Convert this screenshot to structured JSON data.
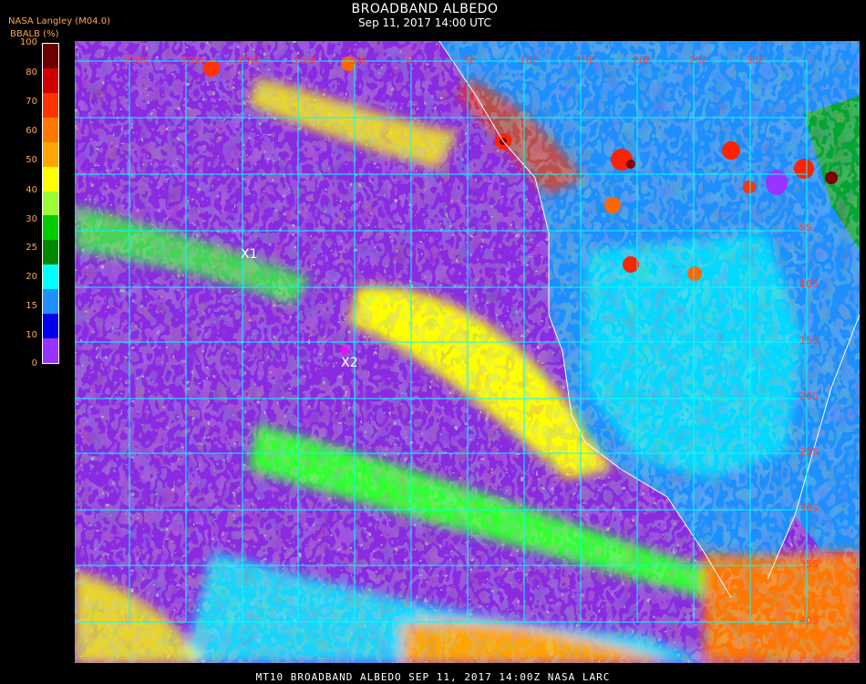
{
  "header": {
    "title": "BROADBAND ALBEDO",
    "subtitle": "Sep 11, 2017 14:00 UTC",
    "source": "NASA Langley (M04.0)",
    "units": "BBALB (%)"
  },
  "colorbar": {
    "ticks": [
      "100",
      "80",
      "70",
      "60",
      "50",
      "40",
      "30",
      "25",
      "20",
      "15",
      "10",
      "0"
    ],
    "colors": [
      "#6b0000",
      "#d00000",
      "#ff3300",
      "#ff7700",
      "#ffa500",
      "#ffff00",
      "#99ff33",
      "#00cc00",
      "#008800",
      "#00ffff",
      "#1e90ff",
      "#0000ee",
      "#9933ff"
    ]
  },
  "map": {
    "longitude_labels": [
      "25W",
      "20W",
      "15W",
      "10W",
      "5W",
      "0",
      "5E",
      "10E",
      "15E",
      "20E",
      "25E",
      "30E"
    ],
    "latitude_labels": [
      "5S",
      "10S",
      "15S",
      "20S",
      "25S",
      "30S",
      "35S",
      "40S"
    ],
    "markers": [
      {
        "label": "X1"
      },
      {
        "label": "X2"
      }
    ],
    "region": "South Atlantic / Southern Africa",
    "colors": {
      "ocean_clear": "#8a2be2",
      "land": "#1e90ff",
      "grid": "#00ffff",
      "coast": "#ffffff",
      "label": "#ff4040"
    }
  },
  "footer": {
    "text": "MT10  BROADBAND ALBEDO   SEP 11, 2017 14:00Z   NASA LARC"
  }
}
